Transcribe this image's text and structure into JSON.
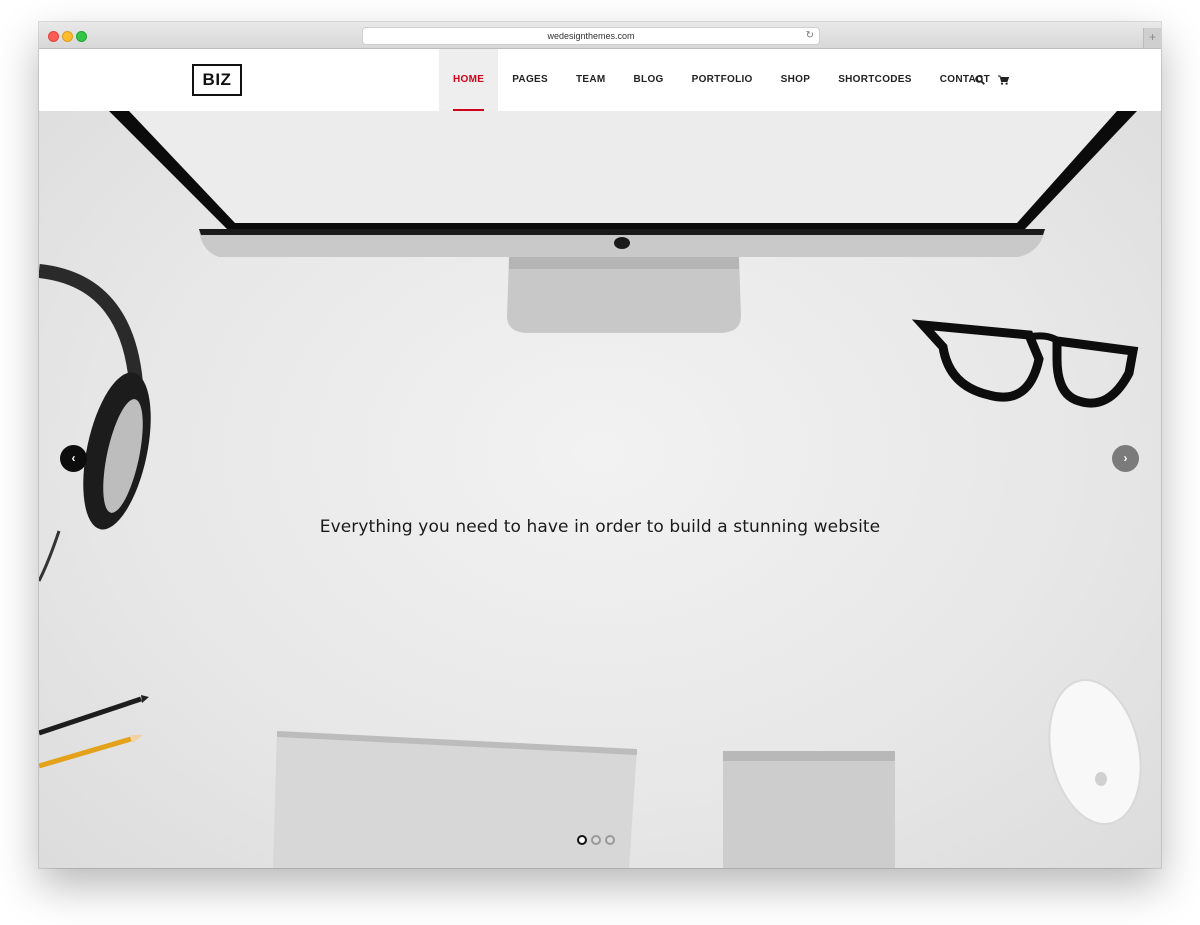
{
  "browser": {
    "url": "wedesignthemes.com",
    "reload_icon": "reload-icon",
    "newtab_label": "+"
  },
  "site": {
    "logo": "BIZ",
    "nav": [
      {
        "label": "HOME",
        "active": true
      },
      {
        "label": "PAGES"
      },
      {
        "label": "TEAM"
      },
      {
        "label": "BLOG"
      },
      {
        "label": "PORTFOLIO"
      },
      {
        "label": "SHOP"
      },
      {
        "label": "SHORTCODES"
      },
      {
        "label": "CONTACT"
      }
    ],
    "icons": {
      "search": "search-icon",
      "cart": "cart-icon"
    },
    "accent_color": "#d0021b"
  },
  "hero": {
    "tagline": "Everything you need to have in order to build a stunning website",
    "prev_arrow": "‹",
    "next_arrow": "›",
    "slides_count": 3,
    "active_slide": 1
  }
}
